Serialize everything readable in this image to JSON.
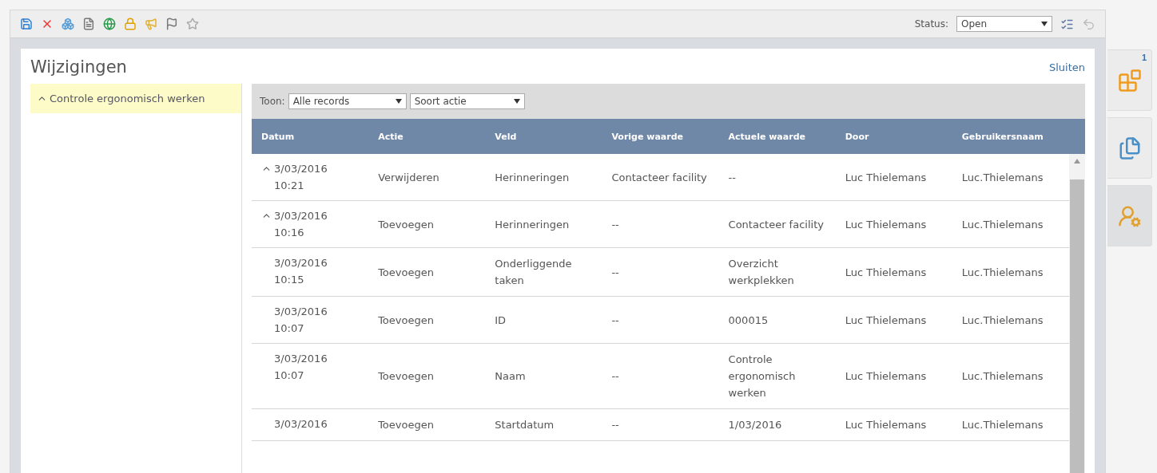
{
  "toolbar": {
    "status_label": "Status:",
    "status_value": "Open"
  },
  "panel": {
    "title": "Wijzigingen",
    "close_link": "Sluiten"
  },
  "tree": [
    {
      "label": "Controle ergonomisch werken",
      "selected": true,
      "expanded": true
    }
  ],
  "filters": {
    "label": "Toon:",
    "record_filter": "Alle records",
    "action_filter": "Soort actie"
  },
  "table": {
    "columns": [
      "Datum",
      "Actie",
      "Veld",
      "Vorige waarde",
      "Actuele waarde",
      "Door",
      "Gebruikersnaam"
    ],
    "rows": [
      {
        "expanded": true,
        "cells": [
          "3/03/2016\n10:21",
          "Verwijderen",
          "Herinneringen",
          "Contacteer facility",
          "--",
          "Luc Thielemans",
          "Luc.Thielemans"
        ]
      },
      {
        "expanded": true,
        "cells": [
          "3/03/2016\n10:16",
          "Toevoegen",
          "Herinneringen",
          "--",
          "Contacteer facility",
          "Luc Thielemans",
          "Luc.Thielemans"
        ]
      },
      {
        "expanded": false,
        "cells": [
          "3/03/2016\n10:15",
          "Toevoegen",
          "Onderliggende\ntaken",
          "--",
          "Overzicht\nwerkplekken",
          "Luc Thielemans",
          "Luc.Thielemans"
        ]
      },
      {
        "expanded": false,
        "cells": [
          "3/03/2016\n10:07",
          "Toevoegen",
          "ID",
          "--",
          "000015",
          "Luc Thielemans",
          "Luc.Thielemans"
        ]
      },
      {
        "expanded": false,
        "cells": [
          "3/03/2016\n10:07",
          "Toevoegen",
          "Naam",
          "--",
          "Controle\nergonomisch\nwerken",
          "Luc Thielemans",
          "Luc.Thielemans"
        ]
      },
      {
        "expanded": false,
        "cells": [
          "3/03/2016",
          "Toevoegen",
          "Startdatum",
          "--",
          "1/03/2016",
          "Luc Thielemans",
          "Luc.Thielemans"
        ]
      }
    ]
  },
  "side_tabs": [
    {
      "badge": "1",
      "selected": false
    },
    {
      "selected": false
    },
    {
      "selected": true
    }
  ]
}
